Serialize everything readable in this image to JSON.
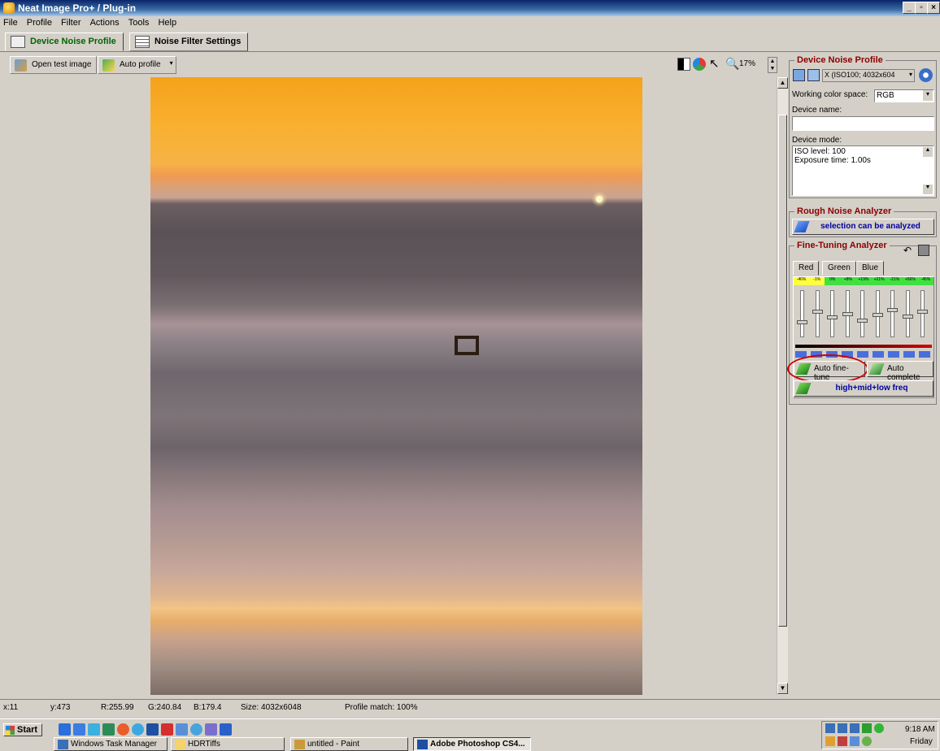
{
  "window": {
    "title": "Neat Image Pro+ / Plug-in"
  },
  "menu": [
    "File",
    "Profile",
    "Filter",
    "Actions",
    "Tools",
    "Help"
  ],
  "tabs": [
    {
      "label": "Device Noise Profile",
      "active": true
    },
    {
      "label": "Noise Filter Settings",
      "active": false
    }
  ],
  "toolbar": {
    "open_test_image": "Open test image",
    "auto_profile": "Auto profile",
    "zoom": "17%"
  },
  "panel": {
    "device_noise_profile": {
      "title": "Device Noise Profile",
      "profile_select": "X (ISO100; 4032x604",
      "working_color_space_label": "Working color space:",
      "working_color_space_value": "RGB",
      "device_name_label": "Device name:",
      "device_name_value": "",
      "device_mode_label": "Device mode:",
      "device_mode_line1": "ISO level: 100",
      "device_mode_line2": "Exposure time: 1.00s"
    },
    "rough_noise_analyzer": {
      "title": "Rough Noise Analyzer",
      "status": "selection can be analyzed"
    },
    "fine_tuning_analyzer": {
      "title": "Fine-Tuning Analyzer",
      "channel_tabs": [
        "Red",
        "Green",
        "Blue"
      ],
      "percent_labels": [
        "-46%",
        "-1%",
        "0%",
        "+8%",
        "+19%",
        "+21%",
        "-21%",
        "+56%",
        "-45%"
      ],
      "auto_fine_tune": "Auto fine-tune",
      "auto_complete": "Auto complete",
      "frequency_mode": "high+mid+low freq",
      "slider_levels_pct": [
        30,
        55,
        42,
        50,
        35,
        48,
        60,
        45,
        55
      ]
    }
  },
  "status": {
    "x": "x:11",
    "y": "y:473",
    "r": "R:255.99",
    "g": "G:240.84",
    "b": "B:179.4",
    "size": "Size: 4032x6048",
    "profile_match": "Profile match: 100%"
  },
  "taskbar": {
    "start": "Start",
    "tasks": [
      "Windows Task Manager",
      "HDRTiffs",
      "untitled - Paint",
      "Adobe Photoshop CS4..."
    ],
    "time": "9:18 AM",
    "day": "Friday"
  },
  "colors": {
    "accent_red": "#8b0000",
    "title_blue": "#0a246a",
    "ok_green": "#00c000"
  }
}
